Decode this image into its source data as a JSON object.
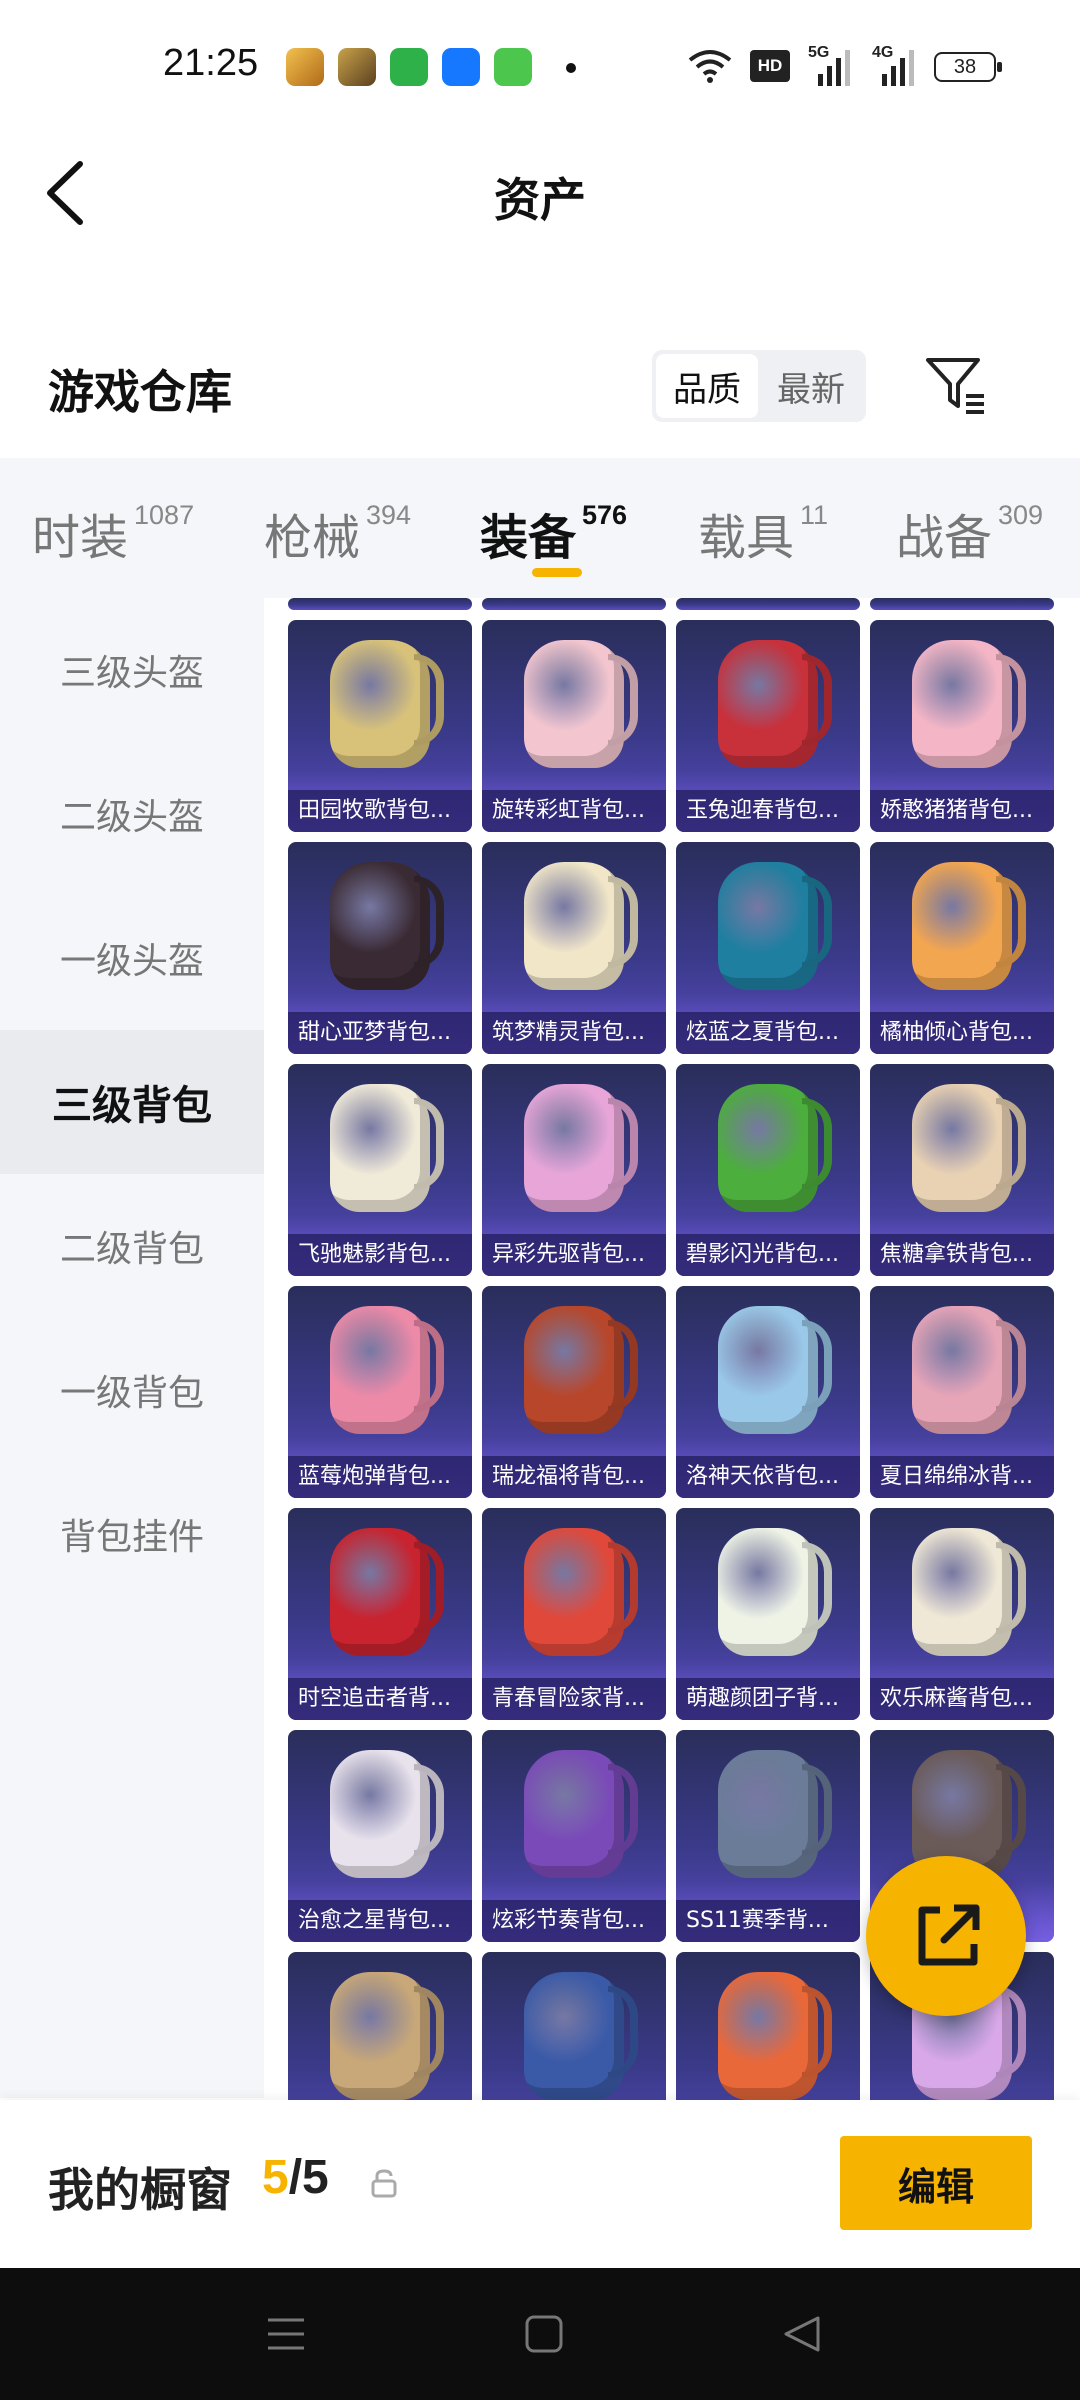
{
  "status_bar": {
    "time": "21:25",
    "battery": "38",
    "network_1": "5G",
    "network_2": "4G",
    "hd_badge": "HD"
  },
  "header": {
    "title": "资产"
  },
  "warehouse": {
    "title": "游戏仓库",
    "sort_quality": "品质",
    "sort_newest": "最新"
  },
  "tabs": [
    {
      "label": "时装",
      "count": "1087"
    },
    {
      "label": "枪械",
      "count": "394"
    },
    {
      "label": "装备",
      "count": "576",
      "active": true
    },
    {
      "label": "载具",
      "count": "11"
    },
    {
      "label": "战备",
      "count": "309"
    }
  ],
  "sidebar": [
    {
      "label": "三级头盔"
    },
    {
      "label": "二级头盔"
    },
    {
      "label": "一级头盔"
    },
    {
      "label": "三级背包",
      "active": true
    },
    {
      "label": "二级背包"
    },
    {
      "label": "一级背包"
    },
    {
      "label": "背包挂件"
    }
  ],
  "items": [
    {
      "name": "田园牧歌背包...",
      "color": "#d8c27a"
    },
    {
      "name": "旋转彩虹背包...",
      "color": "#f3c6cf"
    },
    {
      "name": "玉兔迎春背包...",
      "color": "#c8303a"
    },
    {
      "name": "娇憨猪猪背包...",
      "color": "#f4b6c6"
    },
    {
      "name": "甜心亚梦背包...",
      "color": "#3a2a33"
    },
    {
      "name": "筑梦精灵背包...",
      "color": "#f1e6c8"
    },
    {
      "name": "炫蓝之夏背包...",
      "color": "#1e7fa0"
    },
    {
      "name": "橘柚倾心背包...",
      "color": "#f3a650"
    },
    {
      "name": "飞驰魅影背包...",
      "color": "#f0ead8"
    },
    {
      "name": "异彩先驱背包...",
      "color": "#e8a6d8"
    },
    {
      "name": "碧影闪光背包...",
      "color": "#4cae3c"
    },
    {
      "name": "焦糖拿铁背包...",
      "color": "#e9d2b3"
    },
    {
      "name": "蓝莓炮弹背包...",
      "color": "#ec8aa8"
    },
    {
      "name": "瑞龙福将背包...",
      "color": "#b8462a"
    },
    {
      "name": "洛神天依背包...",
      "color": "#9ac8e8"
    },
    {
      "name": "夏日绵绵冰背...",
      "color": "#e7a5b8"
    },
    {
      "name": "时空追击者背...",
      "color": "#c8232f"
    },
    {
      "name": "青春冒险家背...",
      "color": "#e0483a"
    },
    {
      "name": "萌趣颜团子背...",
      "color": "#eef3e6"
    },
    {
      "name": "欢乐麻酱背包...",
      "color": "#f0e8d6"
    },
    {
      "name": "治愈之星背包...",
      "color": "#e8e2ec"
    },
    {
      "name": "炫彩节奏背包...",
      "color": "#7a4ab8"
    },
    {
      "name": "SS11赛季背...",
      "color": "#6a7c98"
    },
    {
      "name": "",
      "color": "#6a5a58"
    },
    {
      "name": "",
      "color": "#c8a878"
    },
    {
      "name": "",
      "color": "#3a5aa8"
    },
    {
      "name": "",
      "color": "#e8683a"
    },
    {
      "name": "",
      "color": "#d9a8e8"
    }
  ],
  "showcase": {
    "label": "我的橱窗",
    "current": "5",
    "separator": "/",
    "total": "5",
    "edit_label": "编辑"
  },
  "colors": {
    "accent": "#f6b400",
    "card_bg": "#3a3a8a"
  }
}
